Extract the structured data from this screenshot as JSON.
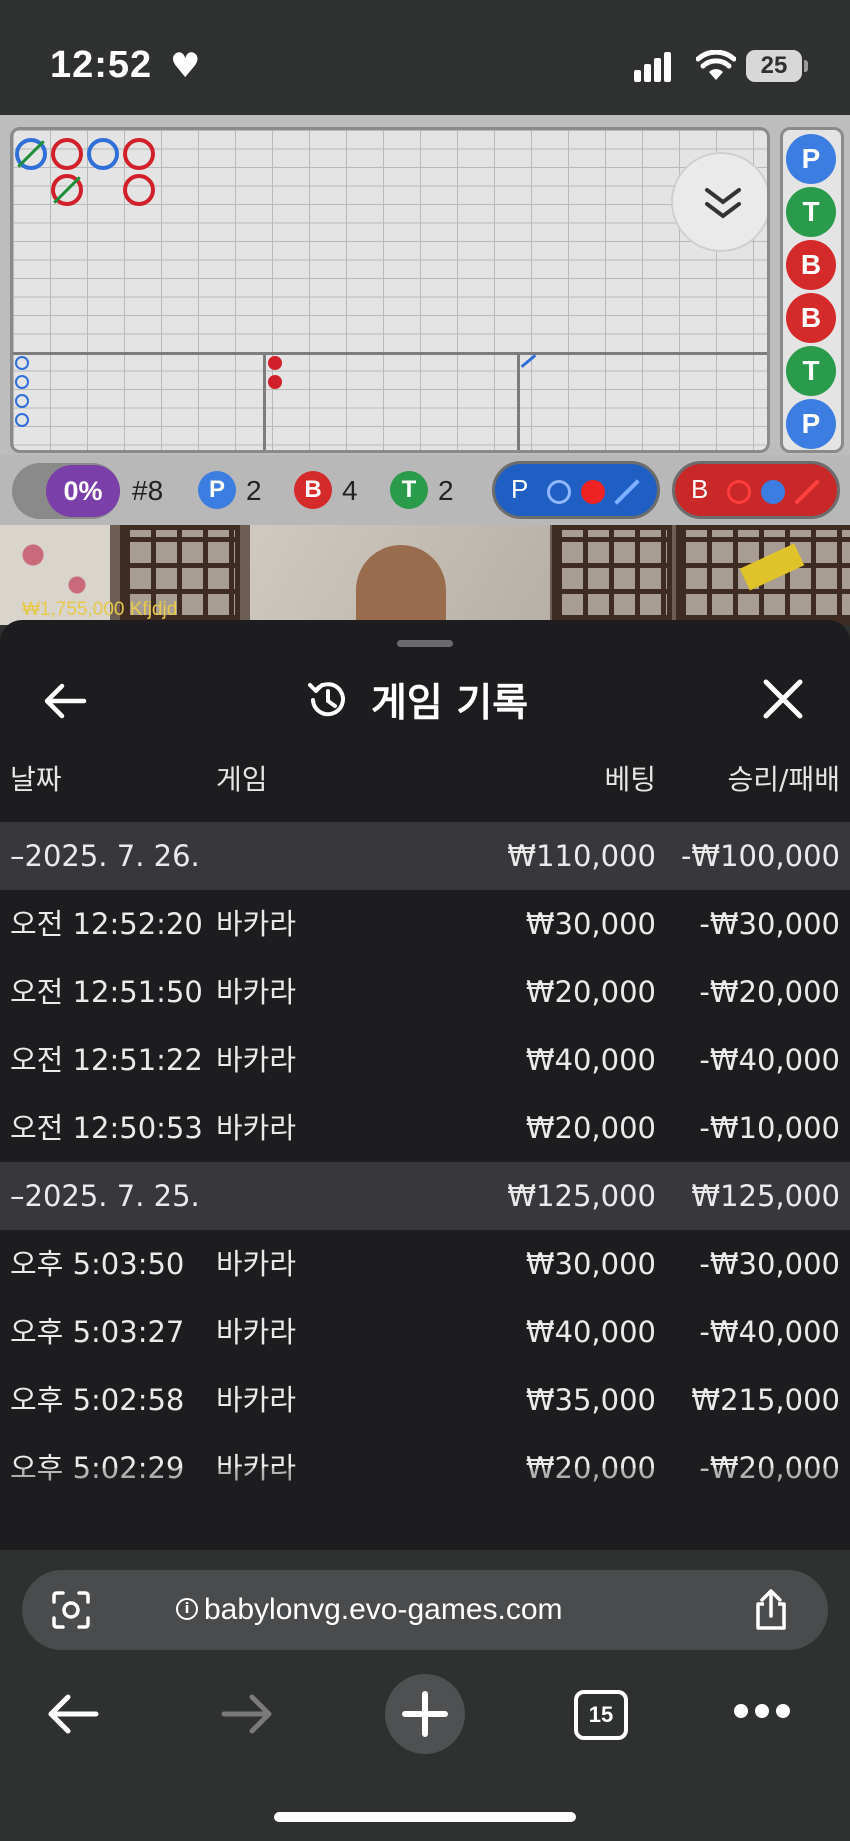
{
  "status": {
    "time": "12:52",
    "battery": "25"
  },
  "stats": {
    "percent": "0%",
    "shoe": "#8",
    "player_label": "P",
    "player_count": "2",
    "banker_label": "B",
    "banker_count": "4",
    "tie_label": "T",
    "tie_count": "2",
    "predict_player_label": "P",
    "predict_banker_label": "B"
  },
  "side_results": [
    "P",
    "T",
    "B",
    "B",
    "T",
    "P"
  ],
  "colors": {
    "player": "#3b7de0",
    "banker": "#d52a2a",
    "tie": "#2a9a4b",
    "accent": "#7a3fa8"
  },
  "video": {
    "balance_text": "₩1,755,000  Kfjdjd"
  },
  "history": {
    "title": "게임 기록",
    "columns": {
      "date": "날짜",
      "game": "게임",
      "bet": "베팅",
      "result": "승리/패배"
    },
    "rows": [
      {
        "type": "group",
        "date": "–2025. 7. 26.",
        "game": "",
        "bet": "₩110,000",
        "result": "-₩100,000"
      },
      {
        "type": "item",
        "date": "오전 12:52:20",
        "game": "바카라",
        "bet": "₩30,000",
        "result": "-₩30,000"
      },
      {
        "type": "item",
        "date": "오전 12:51:50",
        "game": "바카라",
        "bet": "₩20,000",
        "result": "-₩20,000"
      },
      {
        "type": "item",
        "date": "오전 12:51:22",
        "game": "바카라",
        "bet": "₩40,000",
        "result": "-₩40,000"
      },
      {
        "type": "item",
        "date": "오전 12:50:53",
        "game": "바카라",
        "bet": "₩20,000",
        "result": "-₩10,000"
      },
      {
        "type": "group",
        "date": "–2025. 7. 25.",
        "game": "",
        "bet": "₩125,000",
        "result": "₩125,000"
      },
      {
        "type": "item",
        "date": "오후 5:03:50",
        "game": "바카라",
        "bet": "₩30,000",
        "result": "-₩30,000"
      },
      {
        "type": "item",
        "date": "오후 5:03:27",
        "game": "바카라",
        "bet": "₩40,000",
        "result": "-₩40,000"
      },
      {
        "type": "item",
        "date": "오후 5:02:58",
        "game": "바카라",
        "bet": "₩35,000",
        "result": "₩215,000"
      },
      {
        "type": "item",
        "date": "오후 5:02:29",
        "game": "바카라",
        "bet": "₩20,000",
        "result": "-₩20,000"
      }
    ]
  },
  "browser": {
    "url": "babylonvg.evo-games.com",
    "tab_count": "15"
  }
}
